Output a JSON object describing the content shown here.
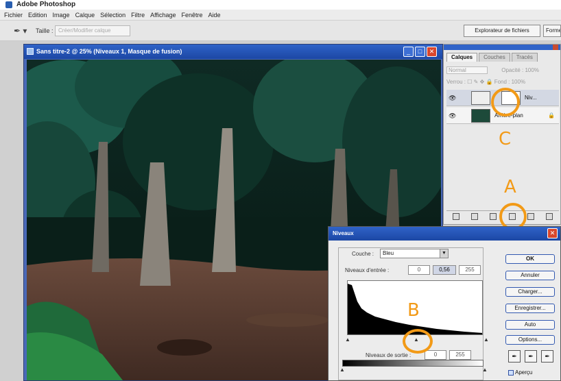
{
  "app": {
    "title": "Adobe Photoshop"
  },
  "menubar": {
    "items": [
      "Fichier",
      "Edition",
      "Image",
      "Calque",
      "Sélection",
      "Filtre",
      "Affichage",
      "Fenêtre",
      "Aide"
    ]
  },
  "options": {
    "tool_label": "Taille :",
    "field_placeholder": "Créer/Modifier calque",
    "file_browser": "Explorateur de fichiers",
    "file_browser2": "Forme"
  },
  "document": {
    "title": "Sans titre-2 @ 25% (Niveaux 1, Masque de fusion)"
  },
  "layers_panel": {
    "tabs": [
      "Calques",
      "Couches",
      "Tracés"
    ],
    "blend_mode": "Normal",
    "opacity_label": "Opacité :",
    "opacity_value": "100%",
    "lock_label": "Verrou :",
    "fill_label": "Fond :",
    "fill_value": "100%",
    "layers": [
      {
        "name": "Niv..."
      },
      {
        "name": "Arrière-plan"
      }
    ]
  },
  "levels_dialog": {
    "title": "Niveaux",
    "channel_label": "Couche :",
    "channel_value": "Bleu",
    "input_label": "Niveaux d'entrée :",
    "input_values": [
      "0",
      "0,56",
      "255"
    ],
    "output_label": "Niveaux de sortie :",
    "output_values": [
      "0",
      "255"
    ],
    "buttons": [
      "OK",
      "Annuler",
      "Charger...",
      "Enregistrer...",
      "Auto",
      "Options..."
    ],
    "preview_label": "Aperçu"
  },
  "callouts": {
    "a": "A",
    "b": "B",
    "c": "C"
  },
  "colors": {
    "callout": "#f29a17",
    "titlebar": "#2f63c8"
  }
}
